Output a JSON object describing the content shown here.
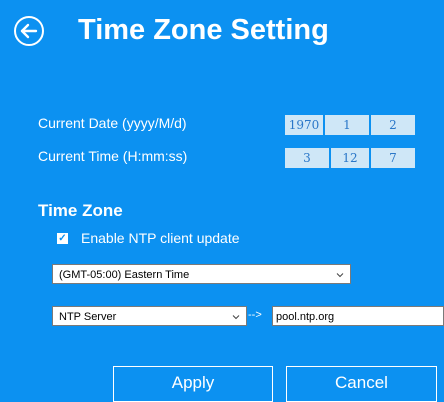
{
  "header": {
    "title": "Time Zone Setting",
    "back_icon": "back-arrow-circle-icon"
  },
  "date_row": {
    "label": "Current Date (yyyy/M/d)",
    "year": "1970",
    "month": "1",
    "day": "2"
  },
  "time_row": {
    "label": "Current Time (H:mm:ss)",
    "hour": "3",
    "minute": "12",
    "second": "7"
  },
  "time_zone": {
    "heading": "Time Zone",
    "ntp_checkbox": {
      "label": "Enable NTP client update",
      "checked": true
    },
    "zone_select": {
      "value": "(GMT-05:00) Eastern Time"
    },
    "server_select": {
      "value": "NTP Server"
    },
    "arrow_text": "-->",
    "server_input": {
      "value": "pool.ntp.org"
    }
  },
  "buttons": {
    "apply": "Apply",
    "cancel": "Cancel"
  },
  "colors": {
    "background": "#0c91f1",
    "field_bg": "#cfe7f7",
    "field_text": "#2a77c8"
  }
}
